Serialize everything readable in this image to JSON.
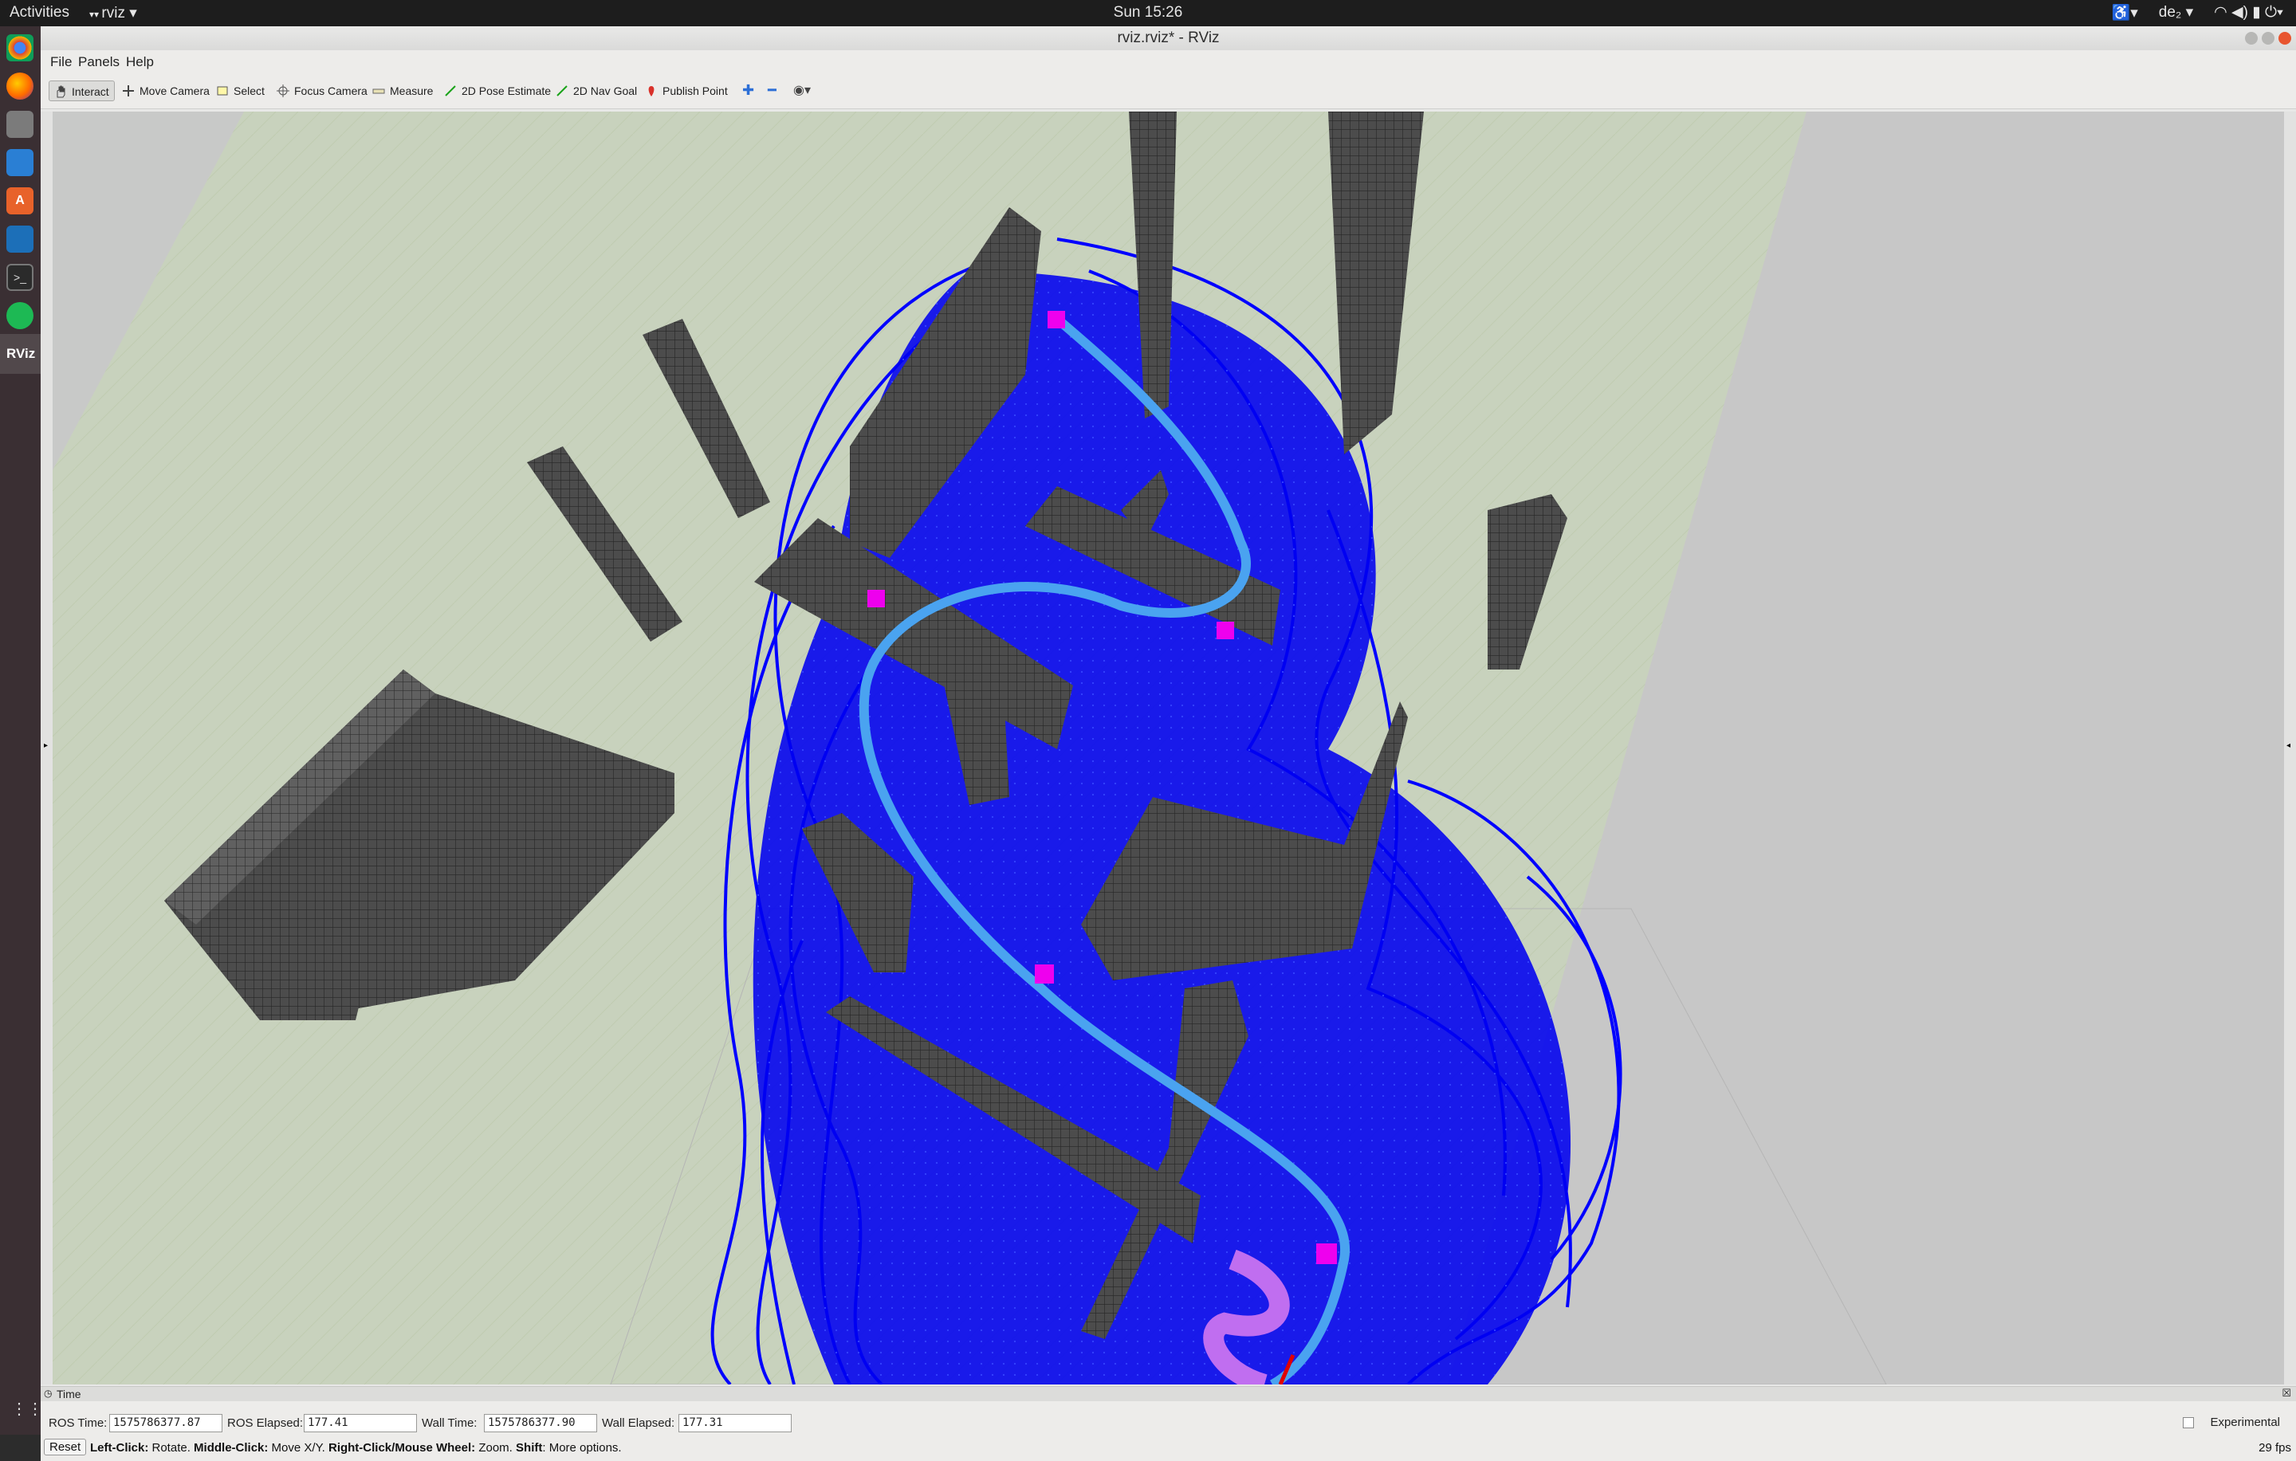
{
  "topbar": {
    "activities": "Activities",
    "app_menu": "rviz",
    "clock": "Sun 15:26",
    "user": "de₂"
  },
  "window": {
    "title": "rviz.rviz* - RViz"
  },
  "menu": {
    "file": "File",
    "panels": "Panels",
    "help": "Help"
  },
  "tools": {
    "interact": "Interact",
    "move_camera": "Move Camera",
    "select": "Select",
    "focus_camera": "Focus Camera",
    "measure": "Measure",
    "pose_estimate": "2D Pose Estimate",
    "nav_goal": "2D Nav Goal",
    "publish_point": "Publish Point"
  },
  "time_panel": {
    "title": "Time",
    "ros_time_label": "ROS Time:",
    "ros_time": "1575786377.87",
    "ros_elapsed_label": "ROS Elapsed:",
    "ros_elapsed": "177.41",
    "wall_time_label": "Wall Time:",
    "wall_time": "1575786377.90",
    "wall_elapsed_label": "Wall Elapsed:",
    "wall_elapsed": "177.31",
    "experimental": "Experimental"
  },
  "status": {
    "reset": "Reset",
    "k1": "Left-Click:",
    "v1": " Rotate. ",
    "k2": "Middle-Click:",
    "v2": " Move X/Y. ",
    "k3": "Right-Click/Mouse Wheel:",
    "v3": " Zoom. ",
    "k4": "Shift",
    "v4": ": More options.",
    "fps": "29 fps"
  },
  "colors": {
    "trajectory": "#0000ff",
    "path": "#4aa3f0",
    "waypoint": "#ee00ee",
    "goal": "#c06ef0",
    "obstacle": "#4a4a4a",
    "ground": "#c9d3bf"
  }
}
